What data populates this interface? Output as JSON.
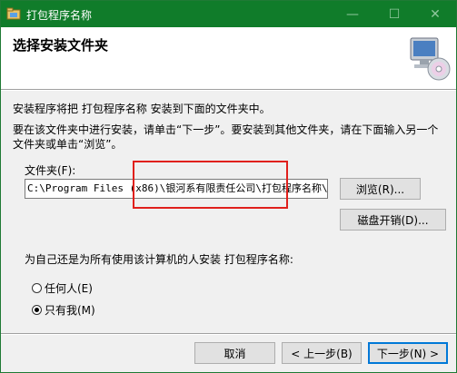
{
  "window": {
    "title": "打包程序名称",
    "minimize_glyph": "—",
    "maximize_glyph": "☐",
    "close_glyph": "✕"
  },
  "header": {
    "title": "选择安装文件夹",
    "icon": "computer-cd-icon"
  },
  "body": {
    "intro": "安装程序将把 打包程序名称 安装到下面的文件夹中。",
    "help": "要在该文件夹中进行安装，请单击“下一步”。要安装到其他文件夹，请在下面输入另一个文件夹或单击“浏览”。",
    "folder_label": "文件夹(F):",
    "folder_value": "C:\\Program Files (x86)\\银河系有限责任公司\\打包程序名称\\",
    "browse_label": "浏览(R)...",
    "disk_cost_label": "磁盘开销(D)...",
    "install_for_label": "为自己还是为所有使用该计算机的人安装 打包程序名称:",
    "radio_everyone": "任何人(E)",
    "radio_just_me": "只有我(M)",
    "selected_option": "just_me"
  },
  "footer": {
    "cancel_label": "取消",
    "back_label": "< 上一步(B)",
    "next_label": "下一步(N) >"
  },
  "colors": {
    "titlebar": "#107c2a",
    "highlight_box": "#e0201c",
    "default_button_border": "#0078d7"
  }
}
